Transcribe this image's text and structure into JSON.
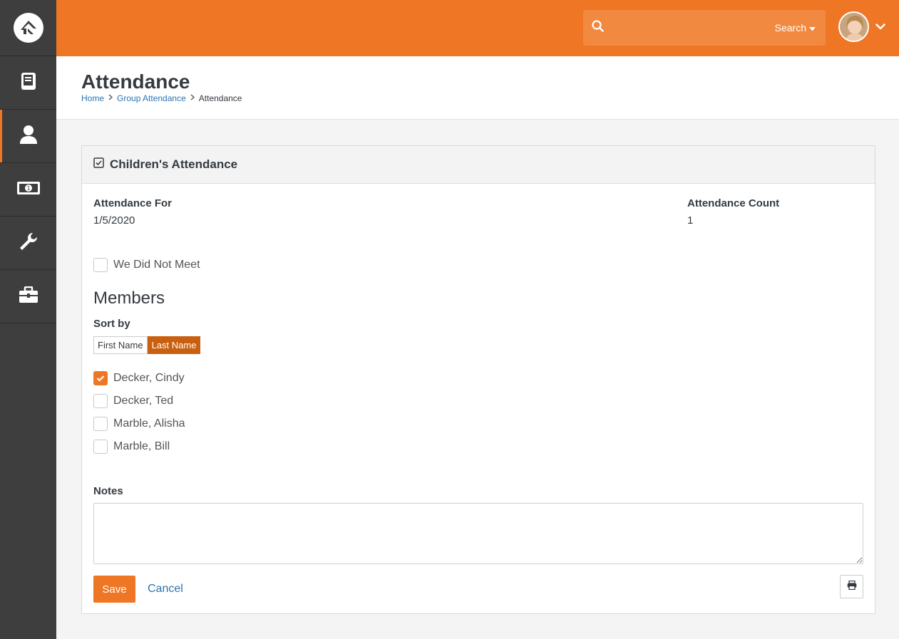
{
  "nav": {
    "logo_icon": "rock-logo-icon",
    "items": [
      {
        "icon": "book-icon"
      },
      {
        "icon": "person-icon",
        "active": true
      },
      {
        "icon": "money-icon"
      },
      {
        "icon": "wrench-icon"
      },
      {
        "icon": "briefcase-icon"
      }
    ]
  },
  "header": {
    "search_placeholder": "",
    "search_button": "Search"
  },
  "page": {
    "title": "Attendance",
    "breadcrumb": [
      "Home",
      "Group Attendance",
      "Attendance"
    ]
  },
  "panel": {
    "title": "Children's Attendance",
    "attendance_for_label": "Attendance For",
    "attendance_for_value": "1/5/2020",
    "attendance_count_label": "Attendance Count",
    "attendance_count_value": "1",
    "did_not_meet_label": "We Did Not Meet",
    "members_title": "Members",
    "sort_by_label": "Sort by",
    "sort_options": [
      "First Name",
      "Last Name"
    ],
    "sort_selected": "Last Name",
    "members": [
      {
        "name": "Decker, Cindy",
        "checked": true
      },
      {
        "name": "Decker, Ted",
        "checked": false
      },
      {
        "name": "Marble, Alisha",
        "checked": false
      },
      {
        "name": "Marble, Bill",
        "checked": false
      }
    ],
    "notes_label": "Notes",
    "notes_value": "",
    "save_label": "Save",
    "cancel_label": "Cancel"
  },
  "colors": {
    "accent": "#ee7625",
    "sidebar": "#3e3e3e",
    "link": "#2c74b3",
    "sort_active": "#c9600f"
  }
}
